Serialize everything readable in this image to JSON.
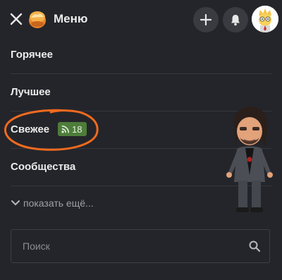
{
  "header": {
    "title": "Меню",
    "close_icon": "close-icon",
    "logo_icon": "pikabu-logo-icon",
    "add_icon": "plus-icon",
    "notifications_icon": "bell-icon",
    "avatar_icon": "user-avatar"
  },
  "nav": {
    "items": [
      {
        "label": "Горячее"
      },
      {
        "label": "Лучшее"
      },
      {
        "label": "Свежее",
        "badge": {
          "icon": "rss-icon",
          "count": "18"
        }
      },
      {
        "label": "Сообщества"
      }
    ],
    "show_more": "показать ещё..."
  },
  "search": {
    "placeholder": "Поиск",
    "icon": "search-icon"
  },
  "colors": {
    "background": "#24252a",
    "badge": "#4e7d3a",
    "annotation": "#f06a1f",
    "divider": "#36373c"
  },
  "decor": {
    "annotation": "orange hand-drawn circle",
    "sticker": "cartoon figure sticker"
  }
}
